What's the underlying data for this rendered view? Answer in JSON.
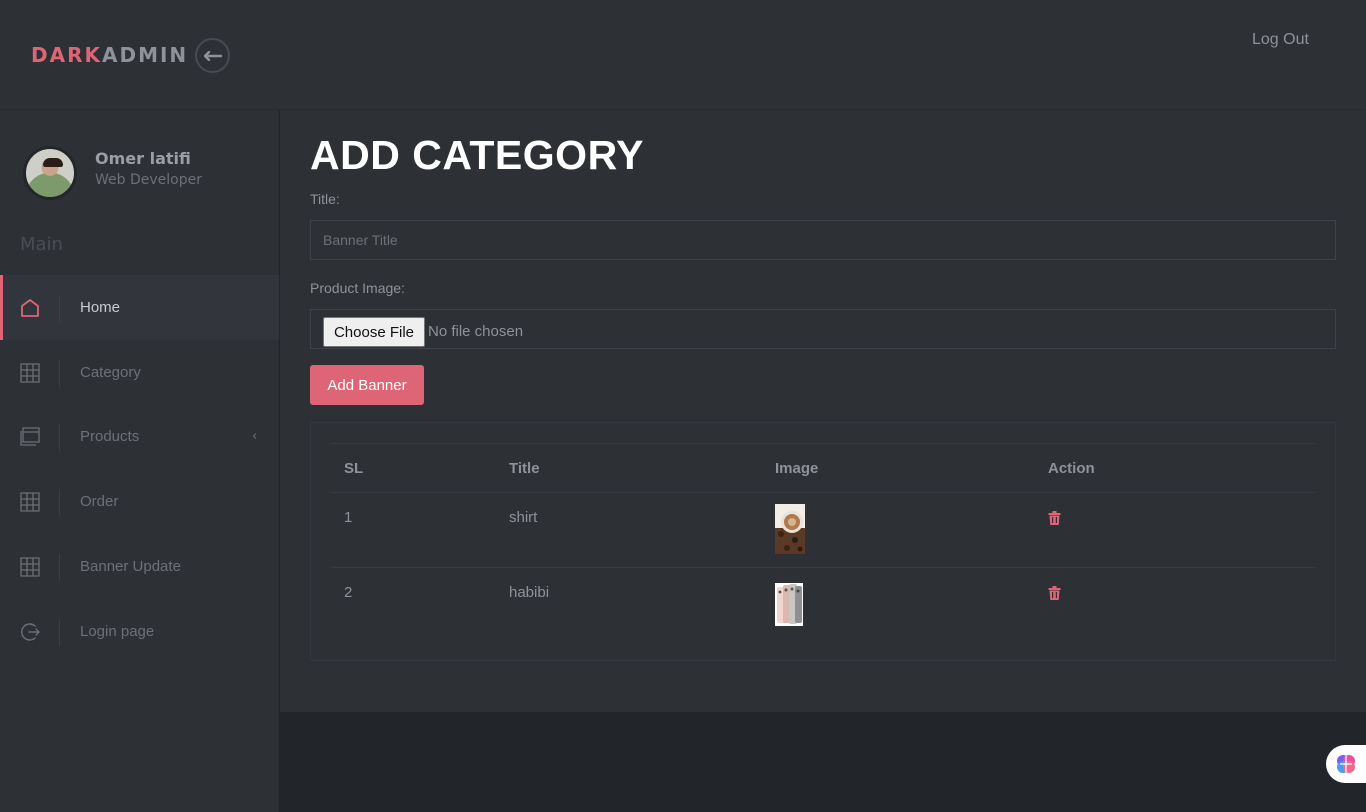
{
  "brand": {
    "part1": "DARK",
    "part2": "ADMIN"
  },
  "header": {
    "logout_label": "Log Out"
  },
  "profile": {
    "name": "Omer latifi",
    "role": "Web Developer"
  },
  "sidebar": {
    "section_label": "Main",
    "items": [
      {
        "label": "Home",
        "icon": "home-icon",
        "active": true
      },
      {
        "label": "Category",
        "icon": "grid-icon"
      },
      {
        "label": "Products",
        "icon": "window-icon",
        "has_submenu": true
      },
      {
        "label": "Order",
        "icon": "grid-icon"
      },
      {
        "label": "Banner Update",
        "icon": "grid-icon"
      },
      {
        "label": "Login page",
        "icon": "logout-icon"
      }
    ]
  },
  "main": {
    "title": "ADD CATEGORY",
    "title_label": "Title:",
    "title_placeholder": "Banner Title",
    "image_label": "Product Image:",
    "file_button": "Choose File",
    "file_status": "No file chosen",
    "submit_label": "Add Banner"
  },
  "table": {
    "headers": [
      "SL",
      "Title",
      "Image",
      "Action"
    ],
    "rows": [
      {
        "sl": "1",
        "title": "shirt",
        "image": "coffee-cup-thumbnail"
      },
      {
        "sl": "2",
        "title": "habibi",
        "image": "phones-thumbnail"
      }
    ]
  },
  "colors": {
    "accent": "#de6576",
    "panel": "#2d3035",
    "background": "#22252a",
    "text_muted": "#8f9298"
  }
}
